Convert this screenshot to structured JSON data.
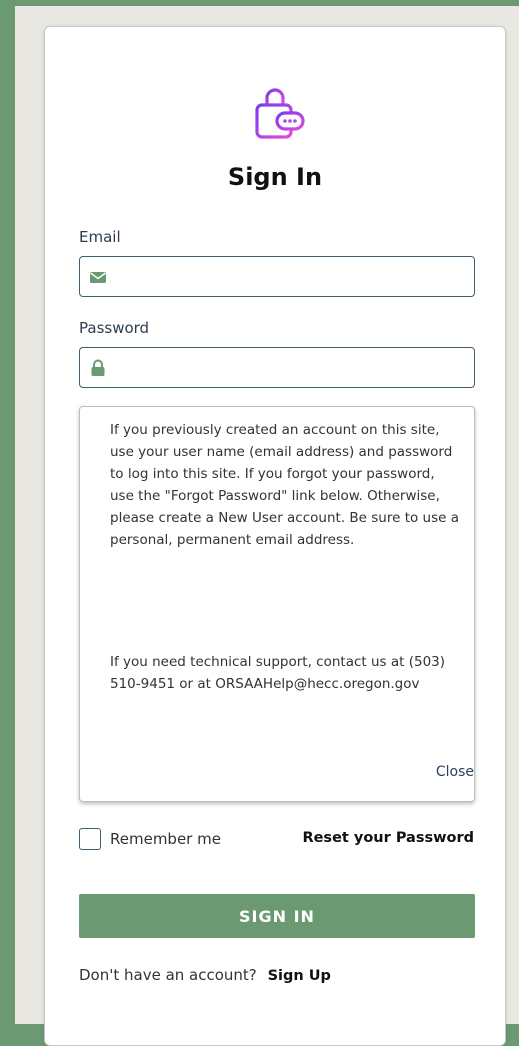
{
  "header": {
    "title": "Sign In"
  },
  "form": {
    "email_label": "Email",
    "email_value": "",
    "password_label": "Password",
    "password_value": ""
  },
  "info": {
    "paragraph1": "If you previously created an account on this site, use your user name (email address) and password to log into this site. If you forgot your password, use the \"Forgot Password\" link below. Otherwise, please create a New User account. Be sure to use a personal, permanent email address.",
    "paragraph2": "If you need technical support, contact us at (503) 510-9451 or at ORSAAHelp@hecc.oregon.gov",
    "close_label": "Close"
  },
  "options": {
    "remember_label": "Remember me",
    "reset_label": "Reset your Password"
  },
  "actions": {
    "signin_label": "SIGN IN",
    "signup_prompt": "Don't have an account?",
    "signup_label": "Sign Up"
  },
  "icons": {
    "logo": "lock-wallet-icon",
    "email": "envelope-icon",
    "password": "lock-icon"
  },
  "colors": {
    "brand_green": "#6b9a72",
    "logo_gradient_start": "#7b3cf0",
    "logo_gradient_end": "#e24bd6"
  }
}
